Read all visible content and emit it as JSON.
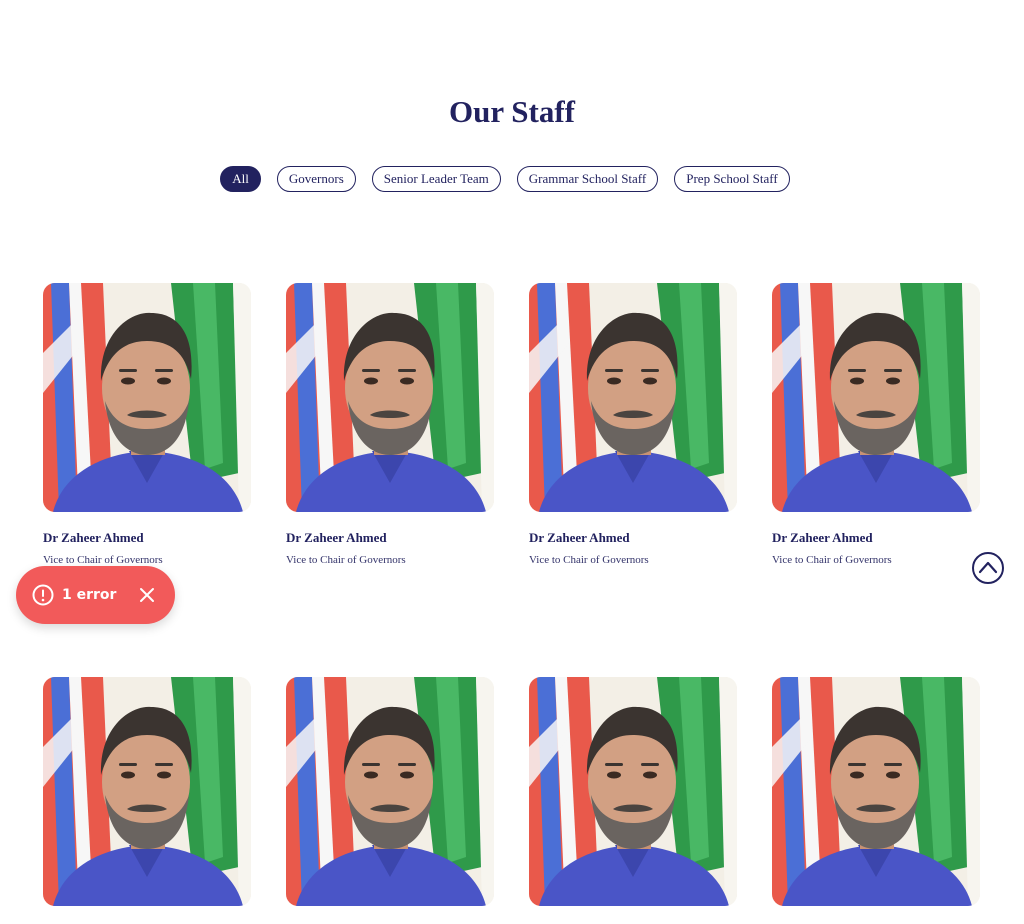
{
  "page": {
    "title": "Our Staff"
  },
  "filters": [
    {
      "label": "All",
      "active": true
    },
    {
      "label": "Governors",
      "active": false
    },
    {
      "label": "Senior Leader Team",
      "active": false
    },
    {
      "label": "Grammar School Staff",
      "active": false
    },
    {
      "label": "Prep School Staff",
      "active": false
    }
  ],
  "staff": [
    {
      "name": "Dr Zaheer Ahmed",
      "role": "Vice to Chair of Governors"
    },
    {
      "name": "Dr Zaheer Ahmed",
      "role": "Vice to Chair of Governors"
    },
    {
      "name": "Dr Zaheer Ahmed",
      "role": "Vice to Chair of Governors"
    },
    {
      "name": "Dr Zaheer Ahmed",
      "role": "Vice to Chair of Governors"
    },
    {
      "name": "",
      "role": ""
    },
    {
      "name": "",
      "role": ""
    },
    {
      "name": "",
      "role": ""
    },
    {
      "name": "",
      "role": ""
    }
  ],
  "error_toast": {
    "text": "1 error",
    "color": "#f25a5a"
  },
  "colors": {
    "brand": "#22225f"
  },
  "icons": {
    "toast": "error-icon",
    "close": "close-icon",
    "scroll_top": "chevron-up-icon"
  }
}
